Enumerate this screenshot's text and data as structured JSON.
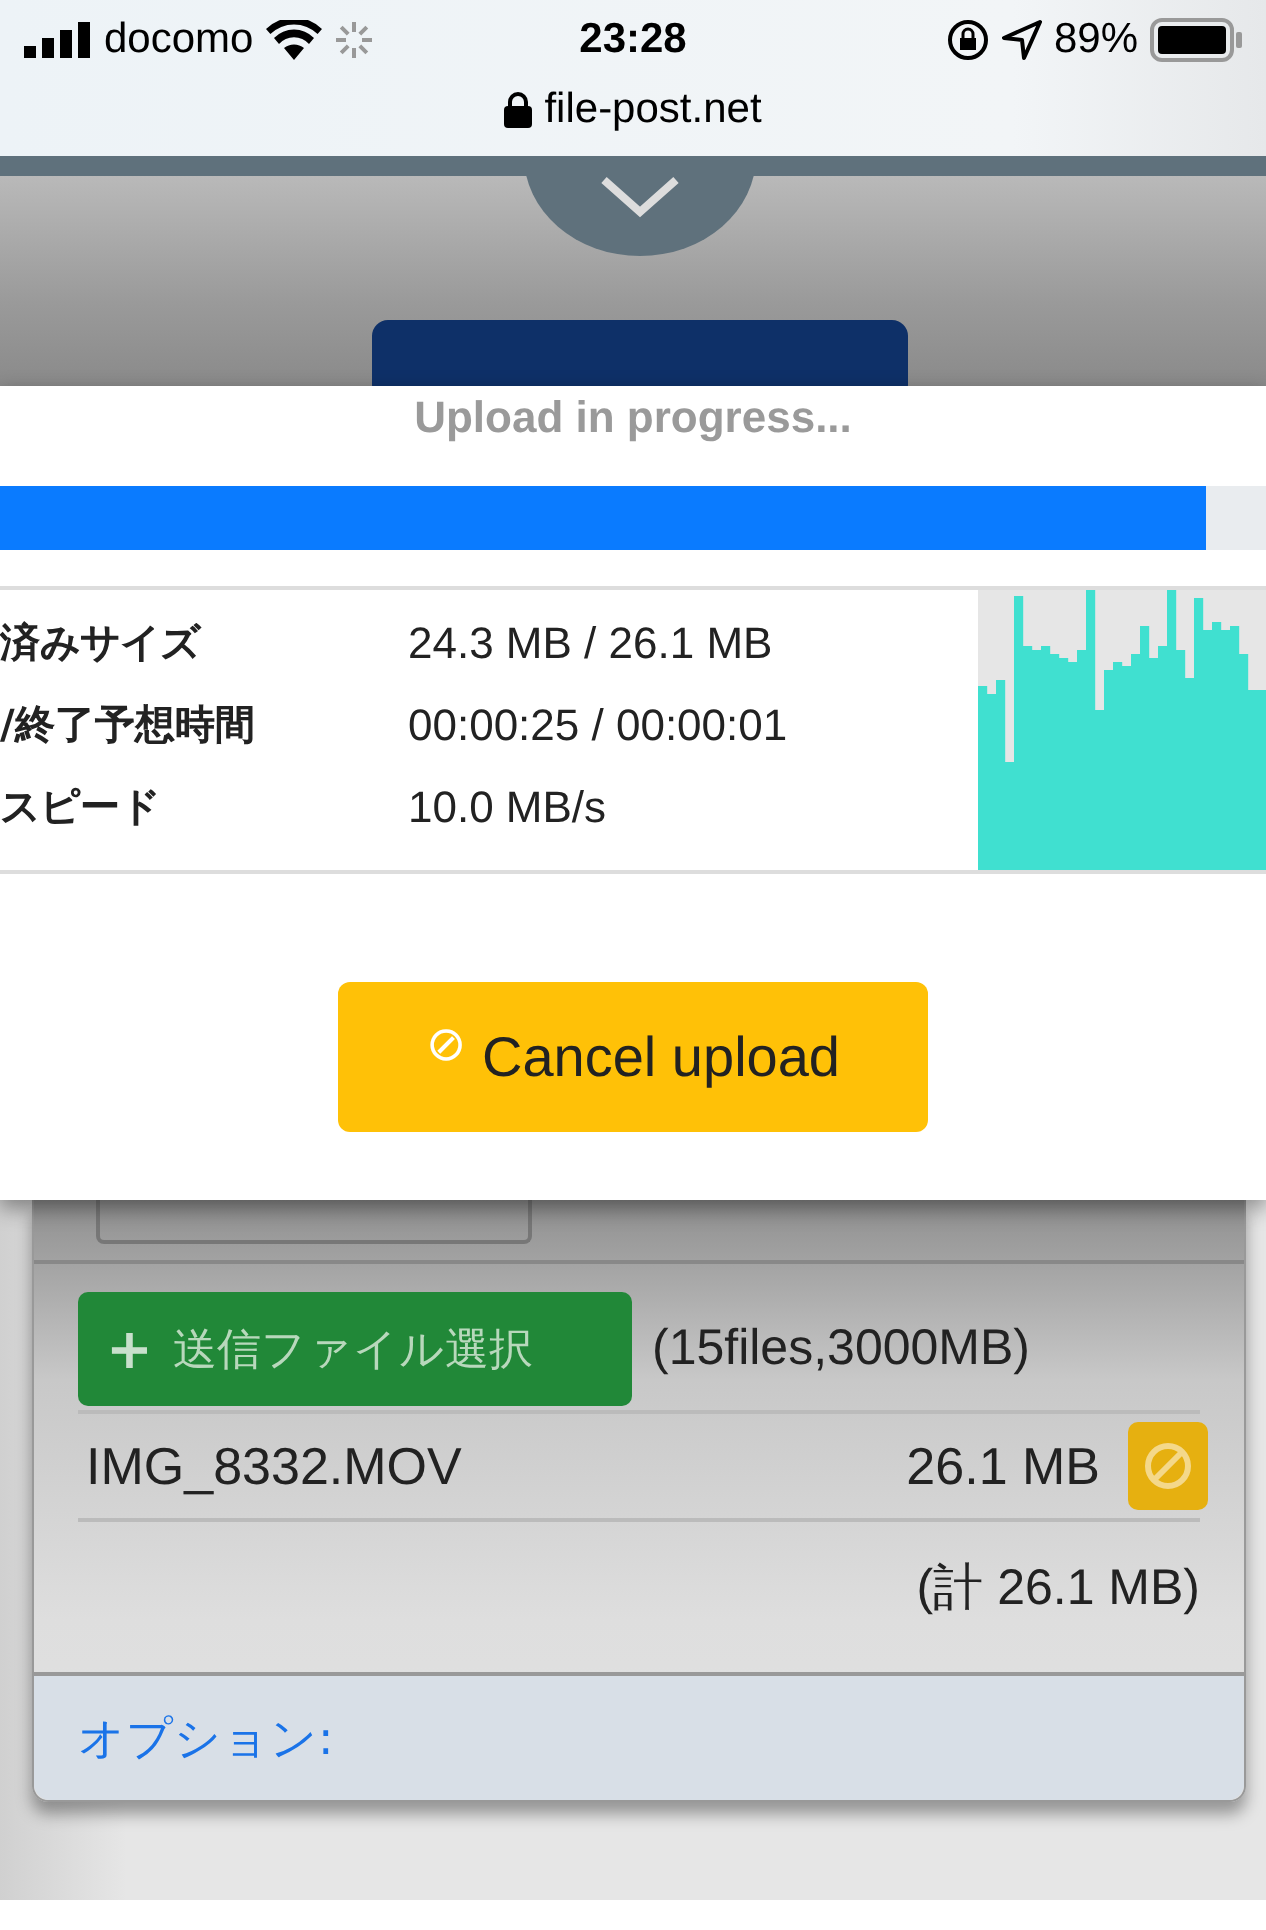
{
  "status_bar": {
    "carrier": "docomo",
    "time": "23:28",
    "battery": "89%"
  },
  "address_bar": {
    "url": "file-post.net"
  },
  "upload_dialog": {
    "title": "Upload in progress...",
    "progress": {
      "level": 0.953
    },
    "stats": [
      {
        "label": "済みサイズ",
        "value": "24.3 MB / 26.1 MB"
      },
      {
        "label": "/終了予想時間",
        "value": "00:00:25 / 00:00:01"
      },
      {
        "label": "スピード",
        "value": "10.0 MB/s"
      }
    ],
    "cancel_button": {
      "icon": "⊘",
      "label": "Cancel upload"
    }
  },
  "upload_form": {
    "select_button": {
      "icon": "+",
      "label": "送信ファイル選択"
    },
    "limit": "(15files,3000MB)",
    "files": [
      {
        "name": "IMG_8332.MOV",
        "size": "26.1 MB"
      }
    ],
    "total": "(計 26.1 MB)",
    "options_link": "オプション:"
  }
}
